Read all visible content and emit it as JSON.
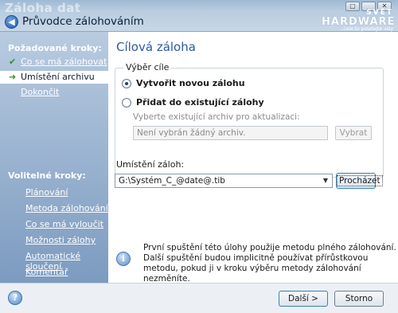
{
  "window": {
    "ghost_title": "Záloha dat",
    "title": "Průvodce zálohováním",
    "back_glyph": "◀",
    "controls": [
      "▢",
      "_",
      "✕"
    ],
    "brand": {
      "line1": "SVĚT",
      "line2": "HARDWARE",
      "line3": "...cele to polatejte vsly"
    }
  },
  "sidebar": {
    "required_heading": "Požadované kroky:",
    "required_steps": [
      {
        "label": "Co se má zálohovat",
        "state": "done",
        "icon": "check-icon"
      },
      {
        "label": "Umístění archivu",
        "state": "current",
        "icon": "arrow-right-icon"
      },
      {
        "label": "Dokončit",
        "state": "pending",
        "icon": ""
      }
    ],
    "optional_heading": "Volitelné kroky:",
    "optional_steps": [
      "Plánování",
      "Metoda zálohování",
      "Co se má vyloučit",
      "Možnosti zálohy",
      "Automatické sloučení",
      "Komentář"
    ]
  },
  "main": {
    "page_title": "Cílová záloha",
    "target_group": {
      "legend": "Výběr cíle",
      "option_new": "Vytvořit novou zálohu",
      "option_existing": "Přidat do existující zálohy",
      "selected": "option_new",
      "hint": "Vyberte existující archiv pro aktualizaci:",
      "archive_field_value": "Není vybrán žádný archiv.",
      "select_button": "Vybrat"
    },
    "location": {
      "label": "Umístění záloh:",
      "value": "G:\\Systém_C_@date@.tib",
      "browse_button": "Procházet"
    },
    "info_text": "První spuštění této úlohy použije metodu plného zálohování. Další spuštění budou implicitně používat přírůstkovou metodu, pokud ji v kroku výběru metody zálohování nezměníte."
  },
  "footer": {
    "help_glyph": "?",
    "next_button": "Další >",
    "cancel_button": "Storno"
  },
  "colors": {
    "accent": "#2a5aa0",
    "sidebar_top": "#b8cbe0",
    "sidebar_bottom": "#7c9bc0"
  }
}
